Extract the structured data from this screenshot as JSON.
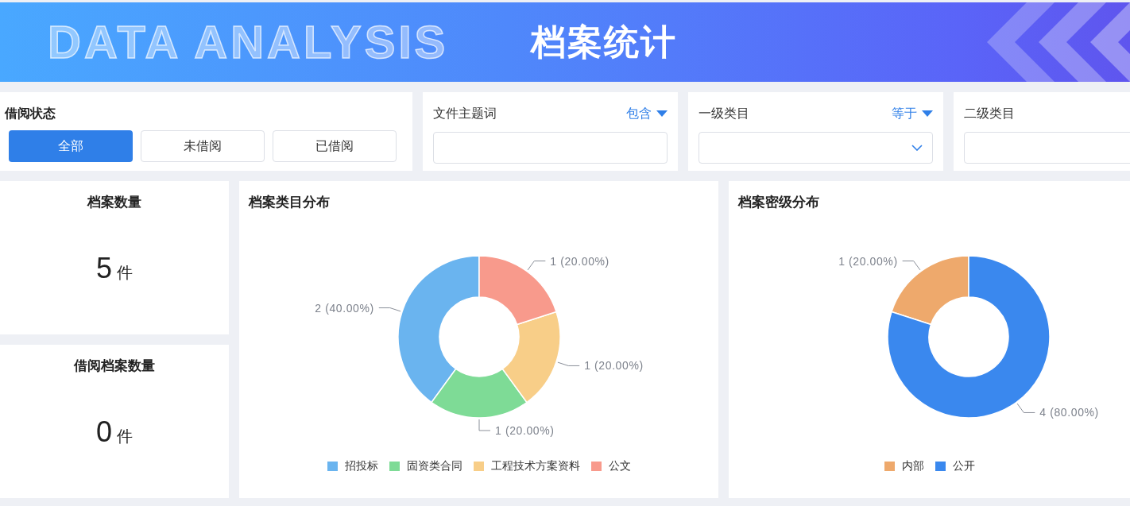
{
  "header": {
    "title": "档案统计",
    "decor_text": "DATA ANALYSIS"
  },
  "filters": {
    "borrow_status": {
      "label": "借阅状态",
      "options": [
        {
          "label": "全部",
          "selected": true
        },
        {
          "label": "未借阅",
          "selected": false
        },
        {
          "label": "已借阅",
          "selected": false
        }
      ]
    },
    "fields": [
      {
        "label": "文件主题词",
        "operator": "包含",
        "kind": "text"
      },
      {
        "label": "一级类目",
        "operator": "等于",
        "kind": "select"
      },
      {
        "label": "二级类目",
        "kind": "text"
      }
    ]
  },
  "stats": [
    {
      "title": "档案数量",
      "value": "5",
      "unit": "件"
    },
    {
      "title": "借阅档案数量",
      "value": "0",
      "unit": "件"
    }
  ],
  "charts": [
    {
      "title": "档案类目分布",
      "chart_data": {
        "type": "donut",
        "categories": [
          "招投标",
          "固资类合同",
          "工程技术方案资料",
          "公文"
        ],
        "values": [
          2,
          1,
          1,
          1
        ],
        "colors": [
          "#6ab4ef",
          "#7edb96",
          "#f8ce88",
          "#f89a8c"
        ],
        "value_labels": [
          "2 (40.00%)",
          "1 (20.00%)",
          "1 (20.00%)",
          "1 (20.00%)"
        ]
      }
    },
    {
      "title": "档案密级分布",
      "chart_data": {
        "type": "donut",
        "categories": [
          "内部",
          "公开"
        ],
        "values": [
          1,
          4
        ],
        "colors": [
          "#eea96c",
          "#3a88ee"
        ],
        "value_labels": [
          "1 (20.00%)",
          "4 (80.00%)"
        ]
      }
    }
  ]
}
